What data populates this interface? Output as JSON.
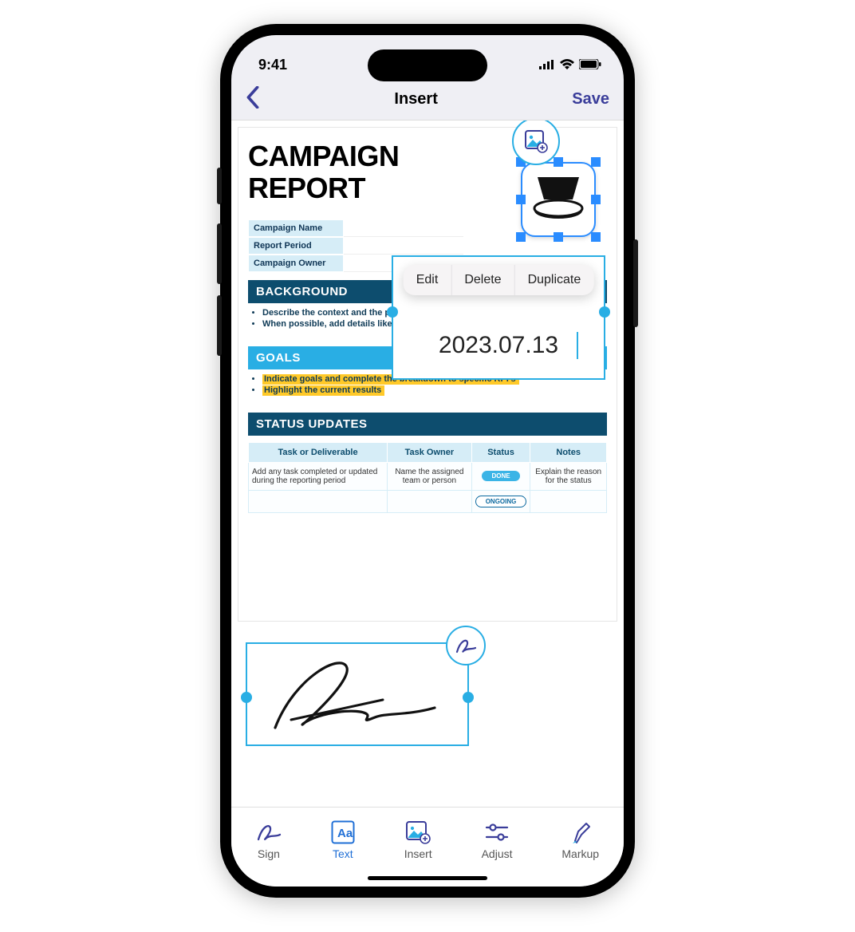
{
  "status": {
    "time": "9:41"
  },
  "nav": {
    "title": "Insert",
    "save": "Save"
  },
  "doc": {
    "title_line1": "CAMPAIGN",
    "title_line2": "REPORT",
    "info_rows": [
      "Campaign Name",
      "Report Period",
      "Campaign Owner"
    ],
    "sections": {
      "background": {
        "heading": "BACKGROUND",
        "bullets": [
          "Describe the context and the problem",
          "When possible, add details like supp"
        ]
      },
      "goals": {
        "heading": "GOALS",
        "bullets": [
          "Indicate goals and complete the breakdown to specific KPI's",
          "Highlight the current results"
        ]
      },
      "status": {
        "heading": "STATUS UPDATES",
        "cols": [
          "Task or Deliverable",
          "Task Owner",
          "Status",
          "Notes"
        ],
        "rows": [
          {
            "task": "Add any task completed or updated during the reporting period",
            "owner": "Name the assigned team or person",
            "status": "DONE",
            "notes": "Explain the reason for the status"
          },
          {
            "task": "",
            "owner": "",
            "status": "ONGOING",
            "notes": ""
          }
        ]
      }
    }
  },
  "textbox": {
    "value": "2023.07.13",
    "menu": [
      "Edit",
      "Delete",
      "Duplicate"
    ]
  },
  "toolbar": {
    "items": [
      {
        "id": "sign",
        "label": "Sign"
      },
      {
        "id": "text",
        "label": "Text"
      },
      {
        "id": "insert",
        "label": "Insert"
      },
      {
        "id": "adjust",
        "label": "Adjust"
      },
      {
        "id": "markup",
        "label": "Markup"
      }
    ],
    "active": "text"
  }
}
